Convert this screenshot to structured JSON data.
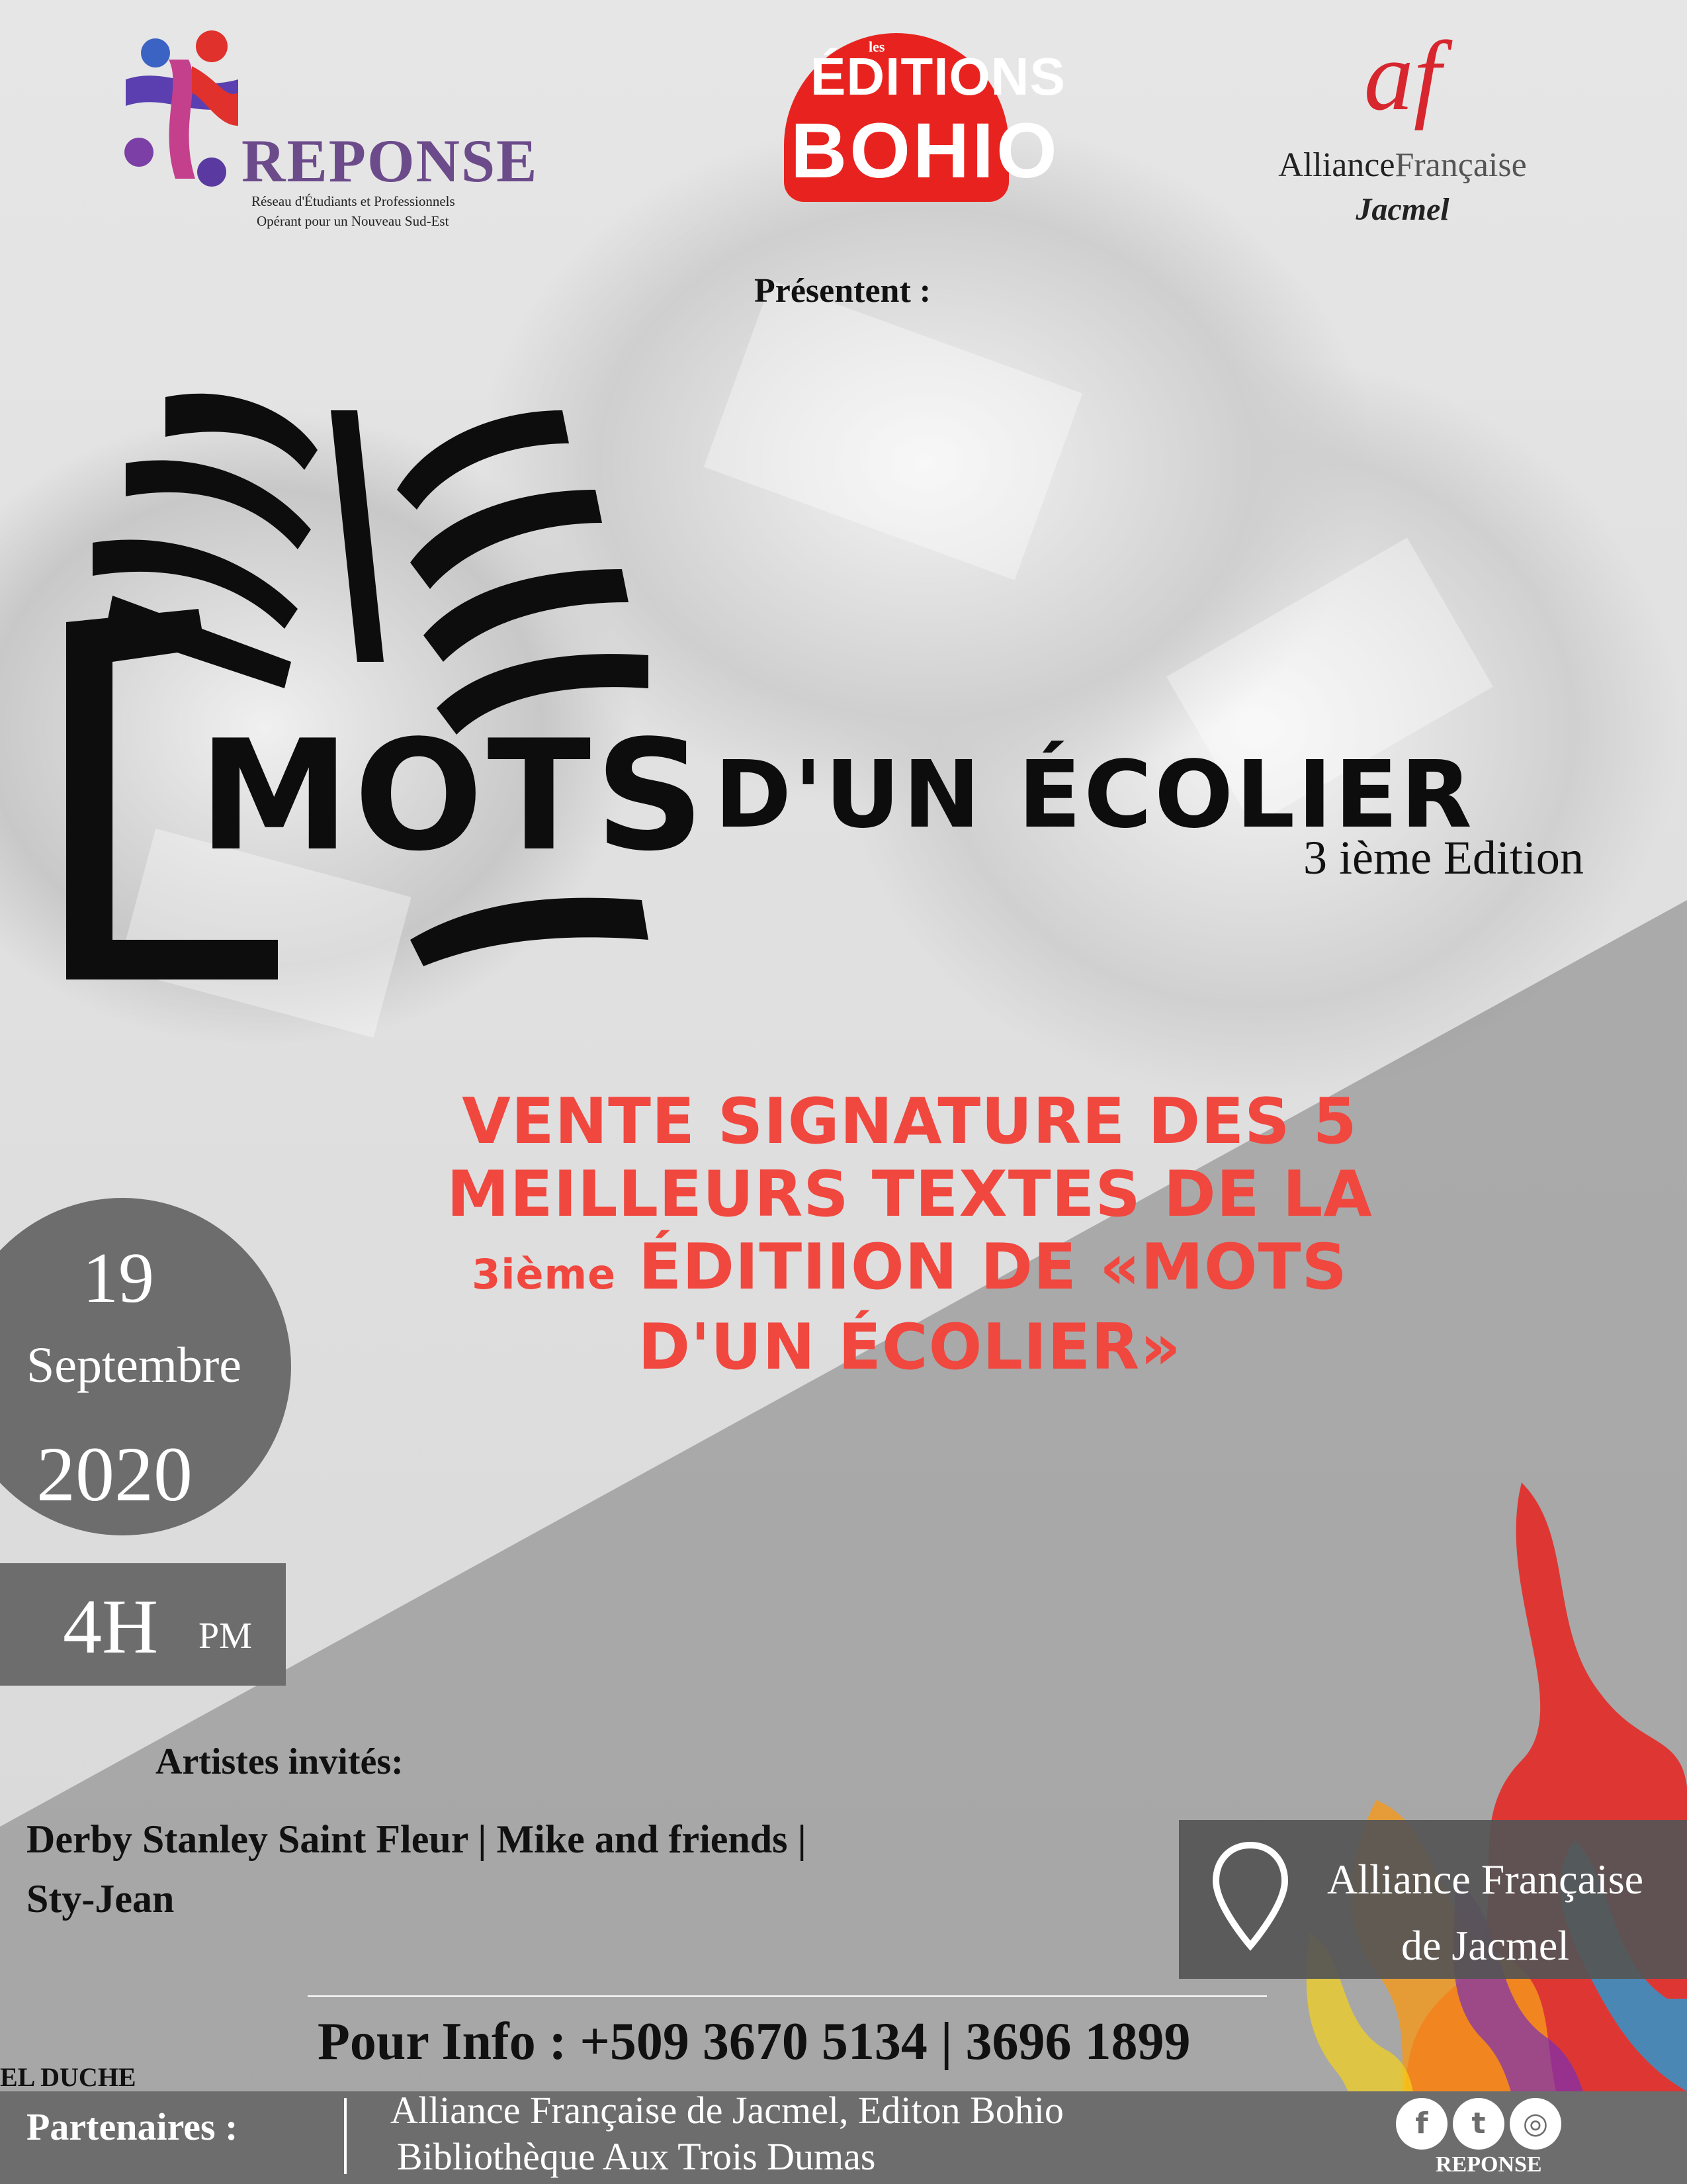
{
  "logos": {
    "reponse": {
      "name": "REPONSE",
      "line1": "Réseau d'Étudiants et Professionnels",
      "line2": "Opérant pour un Nouveau Sud-Est"
    },
    "bohio": {
      "small": "les",
      "line1": "ÉDITIONS",
      "line2": "BOHIO"
    },
    "af": {
      "mark": "af",
      "name_a": "Alliance",
      "name_b": "Française",
      "city": "Jacmel"
    }
  },
  "presentent": "Présentent :",
  "title": {
    "main": "MOTS",
    "rest": "D'UN ÉCOLIER",
    "edition": "3 ième Edition"
  },
  "headline": {
    "line1": "VENTE SIGNATURE DES 5",
    "line2": "MEILLEURS TEXTES DE LA",
    "line3_small": "3ième",
    "line3": " ÉDITIION DE «MOTS",
    "line4": "D'UN ÉCOLIER»"
  },
  "date": {
    "day": "19",
    "month": "Septembre",
    "year": "2020"
  },
  "time": {
    "value": "4H",
    "ampm": "PM"
  },
  "artists": {
    "title": "Artistes invités:",
    "line1": "Derby Stanley Saint Fleur  | Mike and friends  |",
    "line2": "Sty-Jean"
  },
  "venue": {
    "line1": "Alliance Française",
    "line2": "de Jacmel"
  },
  "info": "Pour Info : +509 3670 5134  |  3696 1899",
  "signature": "EL DUCHE",
  "partners": {
    "label": "Partenaires :",
    "line1": "Alliance Française de Jacmel, Editon Bohio",
    "line2": "Bibliothèque Aux Trois Dumas"
  },
  "social": {
    "icons": [
      "facebook-icon",
      "twitter-icon",
      "instagram-icon"
    ],
    "label": "REPONSE"
  },
  "colors": {
    "accent_red": "#f0473f",
    "panel_gray": "#6d6d6d",
    "brand_red": "#e8231f",
    "af_red": "#d7262e"
  }
}
